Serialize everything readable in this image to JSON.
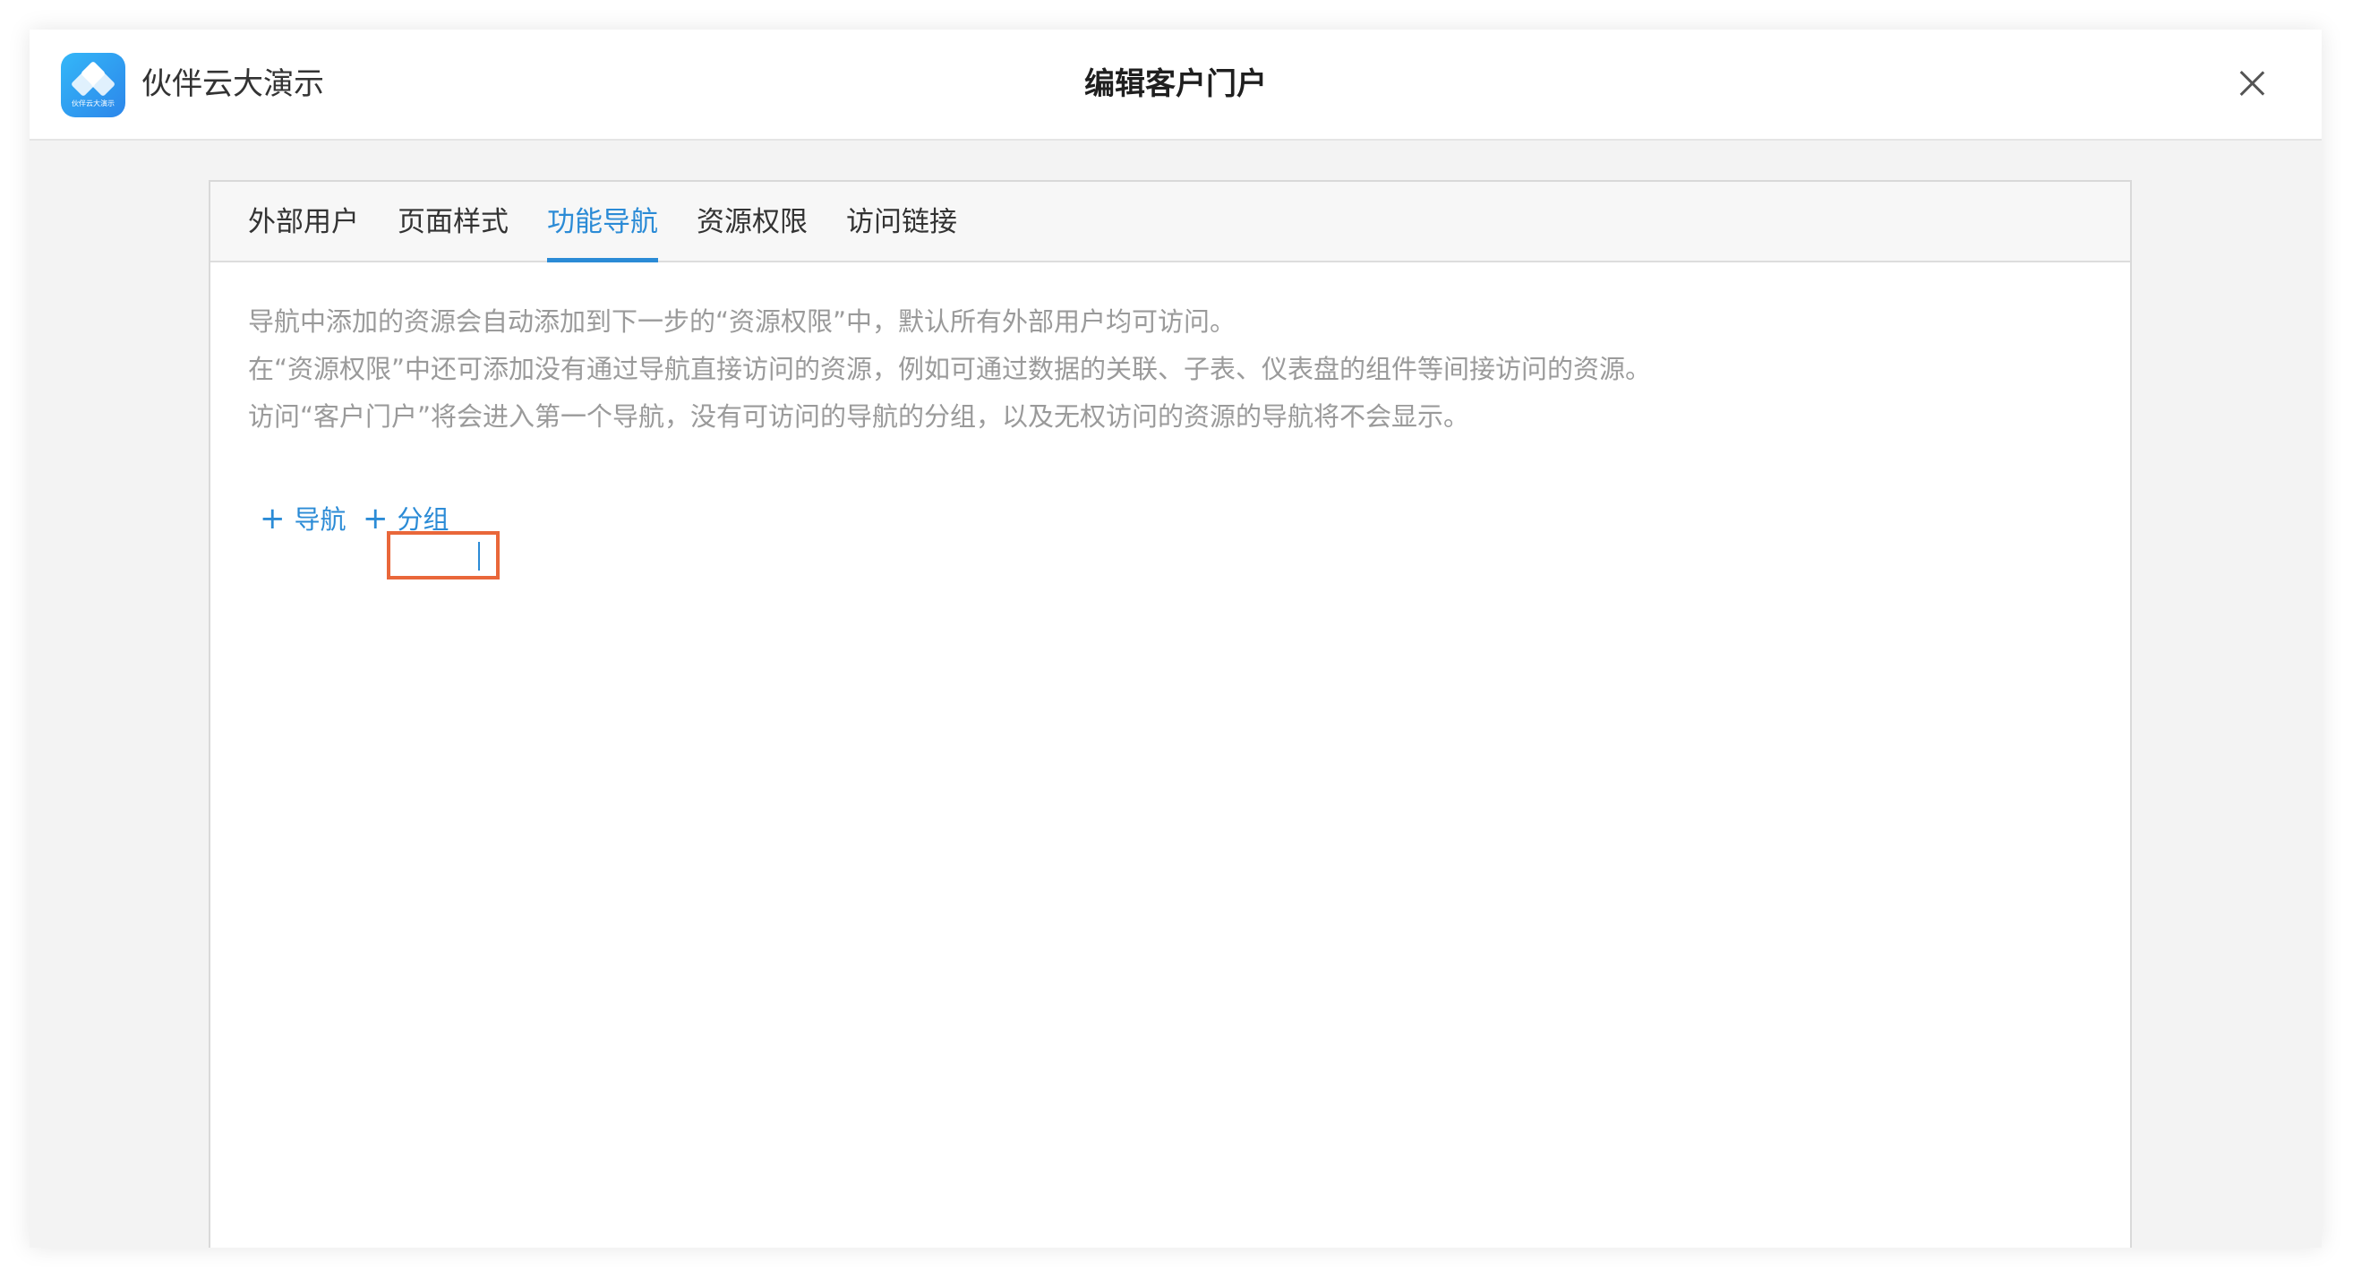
{
  "app": {
    "name": "伙伴云大演示",
    "logo_text": "伙伴云大演示"
  },
  "dialog": {
    "title": "编辑客户门户"
  },
  "tabs": [
    {
      "label": "外部用户",
      "active": false
    },
    {
      "label": "页面样式",
      "active": false
    },
    {
      "label": "功能导航",
      "active": true
    },
    {
      "label": "资源权限",
      "active": false
    },
    {
      "label": "访问链接",
      "active": false
    }
  ],
  "notes": [
    "导航中添加的资源会自动添加到下一步的“资源权限”中，默认所有外部用户均可访问。",
    "在“资源权限”中还可添加没有通过导航直接访问的资源，例如可通过数据的关联、子表、仪表盘的组件等间接访问的资源。",
    "访问“客户门户”将会进入第一个导航，没有可访问的导航的分组，以及无权访问的资源的导航将不会显示。"
  ],
  "actions": {
    "plus_symbol": "+",
    "add_nav_label": "导航",
    "add_group_label": "分组"
  },
  "colors": {
    "accent": "#2b8bd6",
    "highlight": "#e9673a",
    "note_text": "#9a9a9a"
  }
}
